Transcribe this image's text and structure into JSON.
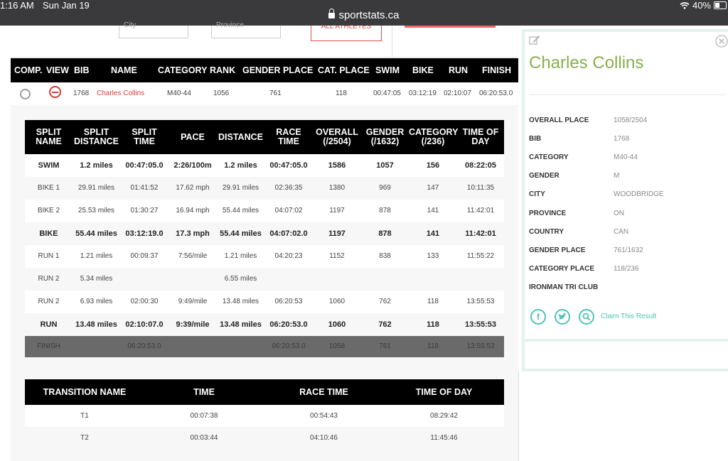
{
  "status_bar": {
    "time": "1:16 AM",
    "date": "Sun Jan 19",
    "url": "sportstats.ca",
    "battery": "40%",
    "battery_level": 0.4
  },
  "filters": {
    "city_placeholder": "City",
    "province_placeholder": "Province",
    "all_athletes_button": "ALL ATHLETES"
  },
  "results_header": {
    "comp": "COMP.",
    "view": "VIEW",
    "bib": "BIB",
    "name": "NAME",
    "category": "CATEGORY",
    "rank": "RANK",
    "gender_place": "GENDER PLACE",
    "cat_place": "CAT. PLACE",
    "swim": "SWIM",
    "bike": "BIKE",
    "run": "RUN",
    "finish": "FINISH"
  },
  "result": {
    "bib": "1768",
    "name": "Charles Collins",
    "category": "M40-44",
    "rank": "1056",
    "gender_place": "761",
    "cat_place": "118",
    "swim": "00:47:05",
    "bike": "03:12:19",
    "run": "02:10:07",
    "finish": "06:20:53.0"
  },
  "splits": {
    "headers": [
      "SPLIT NAME",
      "SPLIT DISTANCE",
      "SPLIT TIME",
      "PACE",
      "DISTANCE",
      "RACE TIME",
      "OVERALL (/2504)",
      "GENDER (/1632)",
      "CATEGORY (/236)",
      "TIME OF DAY"
    ],
    "rows": [
      [
        "SWIM",
        "1.2 miles",
        "00:47:05.0",
        "2:26/100m",
        "1.2 miles",
        "00:47:05.0",
        "1586",
        "1057",
        "156",
        "08:22:05"
      ],
      [
        "BIKE 1",
        "29.91 miles",
        "01:41:52",
        "17.62 mph",
        "29.91 miles",
        "02:36:35",
        "1380",
        "969",
        "147",
        "10:11:35"
      ],
      [
        "BIKE 2",
        "25.53 miles",
        "01:30:27",
        "16.94 mph",
        "55.44 miles",
        "04:07:02",
        "1197",
        "878",
        "141",
        "11:42:01"
      ],
      [
        "BIKE",
        "55.44 miles",
        "03:12:19.0",
        "17.3 mph",
        "55.44 miles",
        "04:07:02.0",
        "1197",
        "878",
        "141",
        "11:42:01"
      ],
      [
        "RUN 1",
        "1.21 miles",
        "00:09:37",
        "7:56/mile",
        "1.21 miles",
        "04:20:23",
        "1152",
        "838",
        "133",
        "11:55:22"
      ],
      [
        "RUN 2",
        "5.34 miles",
        "",
        "",
        "6.55 miles",
        "",
        "",
        "",
        "",
        ""
      ],
      [
        "RUN 2",
        "6.93 miles",
        "02:00:30",
        "9:49/mile",
        "13.48 miles",
        "06:20:53",
        "1060",
        "762",
        "118",
        "13:55:53"
      ],
      [
        "RUN",
        "13.48 miles",
        "02:10:07.0",
        "9:39/mile",
        "13.48 miles",
        "06:20:53.0",
        "1060",
        "762",
        "118",
        "13:55:53"
      ],
      [
        "FINISH",
        "",
        "06:20:53.0",
        "",
        "",
        "06:20:53.0",
        "1058",
        "761",
        "118",
        "13:55:53"
      ]
    ]
  },
  "transitions": {
    "headers": [
      "TRANSITION NAME",
      "TIME",
      "RACE TIME",
      "TIME OF DAY"
    ],
    "rows": [
      [
        "T1",
        "00:07:38",
        "00:54:43",
        "08:29:42"
      ],
      [
        "T2",
        "00:03:44",
        "04:10:46",
        "11:45:46"
      ]
    ]
  },
  "athlete": {
    "name": "Charles Collins",
    "info": [
      {
        "label": "OVERALL PLACE",
        "value": "1058/2504"
      },
      {
        "label": "BIB",
        "value": "1768"
      },
      {
        "label": "CATEGORY",
        "value": "M40-44"
      },
      {
        "label": "GENDER",
        "value": "M"
      },
      {
        "label": "CITY",
        "value": "WOODBRIDGE"
      },
      {
        "label": "PROVINCE",
        "value": "ON"
      },
      {
        "label": "COUNTRY",
        "value": "CAN"
      },
      {
        "label": "GENDER PLACE",
        "value": "761/1632"
      },
      {
        "label": "CATEGORY PLACE",
        "value": "118/236"
      },
      {
        "label": "IRONMAN TRI CLUB",
        "value": ""
      }
    ],
    "claim": "Claim This Result"
  },
  "colors": {
    "accent_green": "#88b04b",
    "teal": "#4fc3b5",
    "red": "#d93a3a"
  },
  "icons": [
    "lock-icon",
    "wifi-icon",
    "battery-icon",
    "radio-icon",
    "minus-circle-icon",
    "edit-icon",
    "close-icon",
    "facebook-icon",
    "twitter-icon",
    "search-icon"
  ]
}
